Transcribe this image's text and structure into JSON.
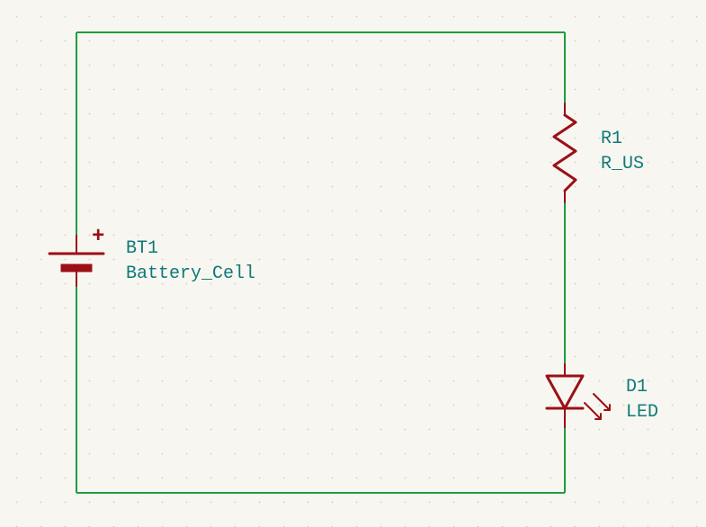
{
  "schematic": {
    "battery": {
      "ref": "BT1",
      "value": "Battery_Cell",
      "polarity": "+"
    },
    "resistor": {
      "ref": "R1",
      "value": "R_US"
    },
    "led": {
      "ref": "D1",
      "value": "LED"
    }
  }
}
